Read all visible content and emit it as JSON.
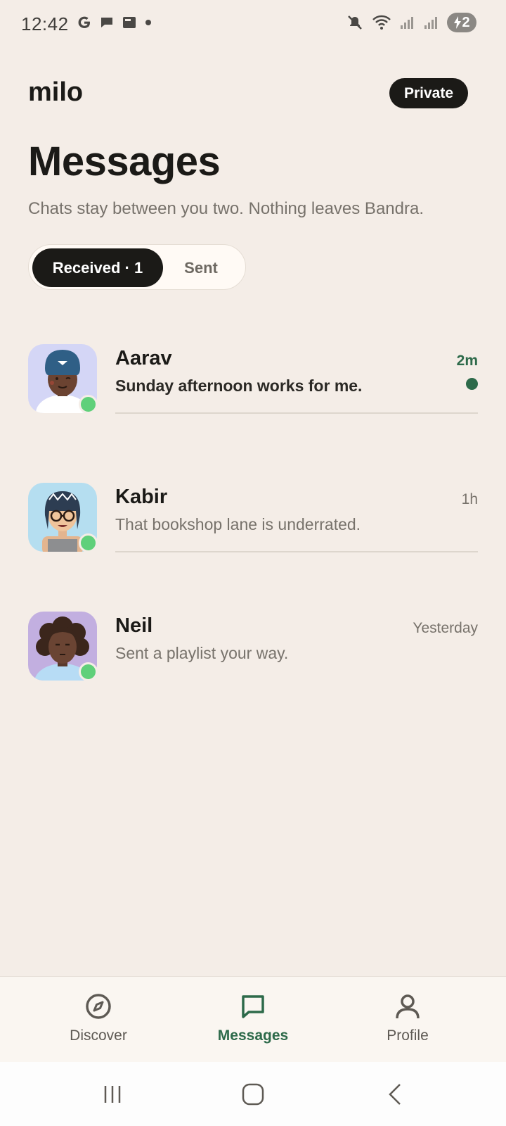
{
  "status_bar": {
    "time": "12:42",
    "battery": "2",
    "left_icons": [
      "google-icon",
      "chat-bubble-icon",
      "news-icon",
      "dot-icon"
    ],
    "right_icons": [
      "mute-icon",
      "wifi-icon",
      "signal-icon",
      "signal-icon",
      "battery-icon"
    ]
  },
  "header": {
    "brand": "milo",
    "badge": "Private",
    "title": "Messages",
    "subtitle": "Chats stay between you two. Nothing leaves Bandra."
  },
  "tabs": {
    "received": "Received · 1",
    "sent": "Sent",
    "active": "received"
  },
  "chats": [
    {
      "name": "Aarav",
      "preview": "Sunday afternoon works for me.",
      "time": "2m",
      "unread": true,
      "online": true,
      "avatar": "avatar-turban"
    },
    {
      "name": "Kabir",
      "preview": "That bookshop lane is underrated.",
      "time": "1h",
      "unread": false,
      "online": true,
      "avatar": "avatar-glasses"
    },
    {
      "name": "Neil",
      "preview": "Sent a playlist your way.",
      "time": "Yesterday",
      "unread": false,
      "online": true,
      "avatar": "avatar-curly"
    }
  ],
  "bottom_nav": [
    {
      "label": "Discover",
      "icon": "compass-icon",
      "active": false
    },
    {
      "label": "Messages",
      "icon": "chat-icon",
      "active": true
    },
    {
      "label": "Profile",
      "icon": "person-icon",
      "active": false
    }
  ],
  "colors": {
    "background": "#f4ede7",
    "accent": "#2d6a4a",
    "dark": "#1b1a17",
    "online": "#5fd07a"
  }
}
